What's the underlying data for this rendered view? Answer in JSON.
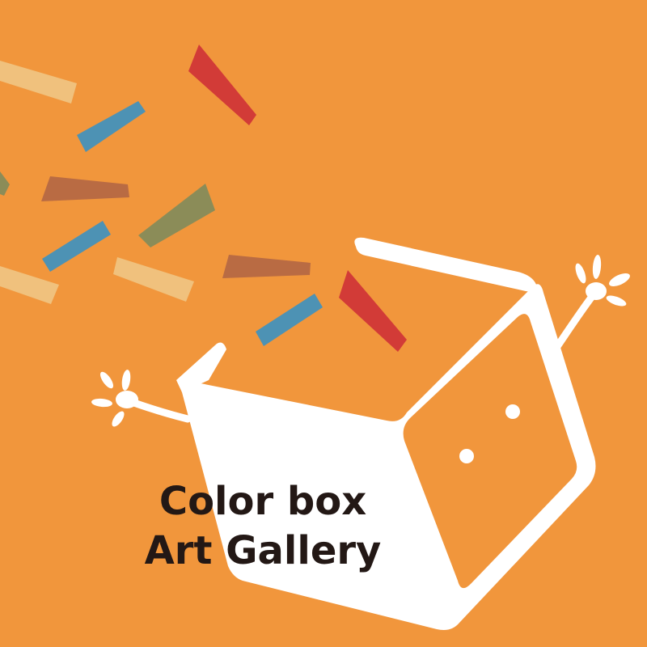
{
  "background_color": "#F1963C",
  "title": {
    "line1": "Color box",
    "line2": "Art Gallery"
  },
  "colors": {
    "box": "#FFFFFF",
    "text": "#231815",
    "confetti_red": "#D23B37",
    "confetti_blue": "#4D92B4",
    "confetti_brown": "#B96B43",
    "confetti_olive": "#8B8C58",
    "confetti_sand": "#F0C17D"
  },
  "illustration": {
    "subject": "cheerful box character with raised arms and a face",
    "icon": "color-box-mascot-icon"
  }
}
